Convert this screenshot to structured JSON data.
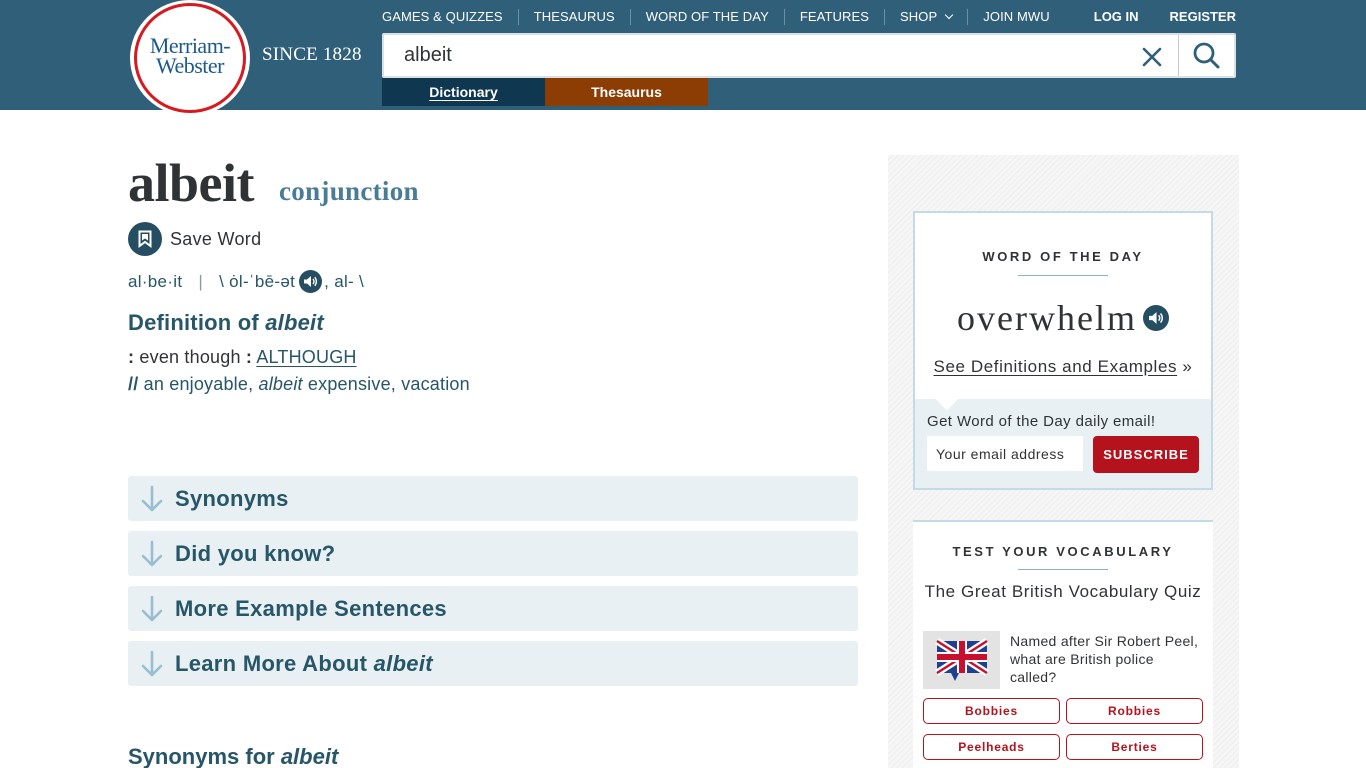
{
  "header": {
    "logo_line1": "Merriam-",
    "logo_line2": "Webster",
    "since": "SINCE 1828",
    "nav": [
      {
        "label": "GAMES & QUIZZES"
      },
      {
        "label": "THESAURUS"
      },
      {
        "label": "WORD OF THE DAY"
      },
      {
        "label": "FEATURES"
      },
      {
        "label": "SHOP"
      },
      {
        "label": "JOIN MWU"
      }
    ],
    "login": "LOG IN",
    "register": "REGISTER",
    "search_value": "albeit",
    "tabs": {
      "dictionary": "Dictionary",
      "thesaurus": "Thesaurus"
    }
  },
  "entry": {
    "headword": "albeit",
    "part_of_speech": "conjunction",
    "save_label": "Save Word",
    "syllables": "al·be·it",
    "separator": "|",
    "pron_open": "\\ ȯl-ˈbē-ət",
    "pron_rest": ", al- \\",
    "definition_heading_prefix": "Definition of ",
    "definition_heading_word": "albeit",
    "def_colon1": ":",
    "def_text": " even though ",
    "def_colon2": ":",
    "def_link": "ALTHOUGH",
    "example_slashes": "//",
    "example_pre": " an enjoyable, ",
    "example_word": "albeit",
    "example_post": " expensive, vacation"
  },
  "sections": [
    {
      "label": "Synonyms"
    },
    {
      "label": "Did you know?"
    },
    {
      "label": "More Example Sentences"
    },
    {
      "label": "Learn More About ",
      "italic": "albeit"
    }
  ],
  "synonyms_heading": {
    "prefix": "Synonyms for ",
    "word": "albeit"
  },
  "word_of_the_day": {
    "kicker": "WORD OF THE DAY",
    "word": "overwhelm",
    "link": "See Definitions and Examples",
    "link_suffix": " »",
    "email_label": "Get Word of the Day daily email!",
    "email_placeholder": "Your email address",
    "subscribe": "SUBSCRIBE"
  },
  "vocabulary": {
    "kicker": "TEST YOUR VOCABULARY",
    "quiz_title": "The Great British Vocabulary Quiz",
    "question": "Named after Sir Robert Peel, what are British police called?",
    "answers": [
      "Bobbies",
      "Robbies",
      "Peelheads",
      "Berties"
    ]
  },
  "colors": {
    "header_bg": "#305f7a",
    "dictionary_tab": "#0f3850",
    "thesaurus_tab": "#8b3d03",
    "accent_red": "#b4121d",
    "link_blue": "#265667",
    "accordion_bg": "#e8f0f4"
  }
}
